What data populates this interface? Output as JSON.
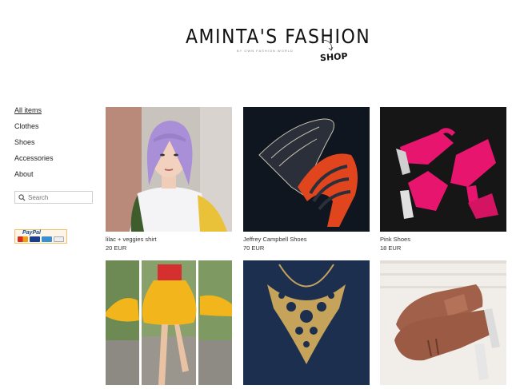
{
  "header": {
    "logo_title": "AMINTA'S FASHION",
    "logo_subtitle": "BY OWN FASHION WORLD",
    "logo_shop": "SHOP"
  },
  "sidebar": {
    "items": [
      {
        "label": "All items",
        "active": true
      },
      {
        "label": "Clothes",
        "active": false
      },
      {
        "label": "Shoes",
        "active": false
      },
      {
        "label": "Accessories",
        "active": false
      },
      {
        "label": "About",
        "active": false
      }
    ],
    "search": {
      "placeholder": "Search",
      "icon": "search-icon"
    },
    "payment": {
      "label": "PayPal",
      "cards": [
        "mastercard",
        "visa",
        "amex",
        "discover"
      ]
    }
  },
  "products": [
    {
      "name": "lilac + veggies shirt",
      "price": "20 EUR"
    },
    {
      "name": "Jeffrey Campbell Shoes",
      "price": "70 EUR"
    },
    {
      "name": "Pink Shoes",
      "price": "18 EUR"
    },
    {
      "name": "",
      "price": ""
    },
    {
      "name": "",
      "price": ""
    },
    {
      "name": "",
      "price": ""
    }
  ],
  "colors": {
    "lilac_hair": "#a98fd8",
    "pink_shoes": "#e8156e",
    "yellow_skirt": "#f2b51b",
    "gold_necklace": "#c6a35a",
    "brown_shoes": "#a0604a"
  }
}
